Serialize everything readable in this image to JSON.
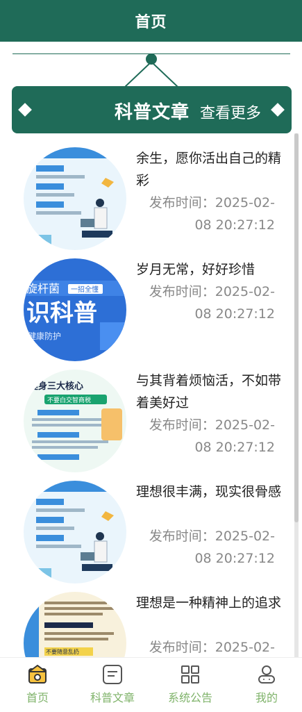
{
  "header": {
    "title": "首页"
  },
  "section": {
    "title": "科普文章",
    "more_label": "查看更多"
  },
  "articles": [
    {
      "title": "余生，愿你活出自己的精彩",
      "time_label": "发布时间：",
      "time": "2025-02-08 20:27:12"
    },
    {
      "title": "岁月无常，好好珍惜",
      "time_label": "发布时间：",
      "time": "2025-02-08 20:27:12"
    },
    {
      "title": "与其背着烦恼活，不如带着美好过",
      "time_label": "发布时间：",
      "time": "2025-02-08 20:27:12"
    },
    {
      "title": "理想很丰满，现实很骨感",
      "time_label": "发布时间：",
      "time": "2025-02-08 20:27:12"
    },
    {
      "title": "理想是一种精神上的追求",
      "time_label": "发布时间：",
      "time": "2025-02-"
    }
  ],
  "thumbnail_texts": {
    "card2_line1": "旋杆菌",
    "card2_tag": "一招全懂",
    "card2_big": "识科普",
    "card2_line3": "健康防护",
    "card3_title": "健身三大核心",
    "card3_sub": "不要白交智商税",
    "card5_line": "不要随意乱扔"
  },
  "tabbar": {
    "items": [
      {
        "label": "首页",
        "icon": "home-icon"
      },
      {
        "label": "科普文章",
        "icon": "article-icon"
      },
      {
        "label": "系统公告",
        "icon": "grid-icon"
      },
      {
        "label": "我的",
        "icon": "profile-icon"
      }
    ]
  },
  "colors": {
    "primary": "#1f6b58",
    "tab_label": "#7fb36a",
    "muted_text": "#888888"
  }
}
